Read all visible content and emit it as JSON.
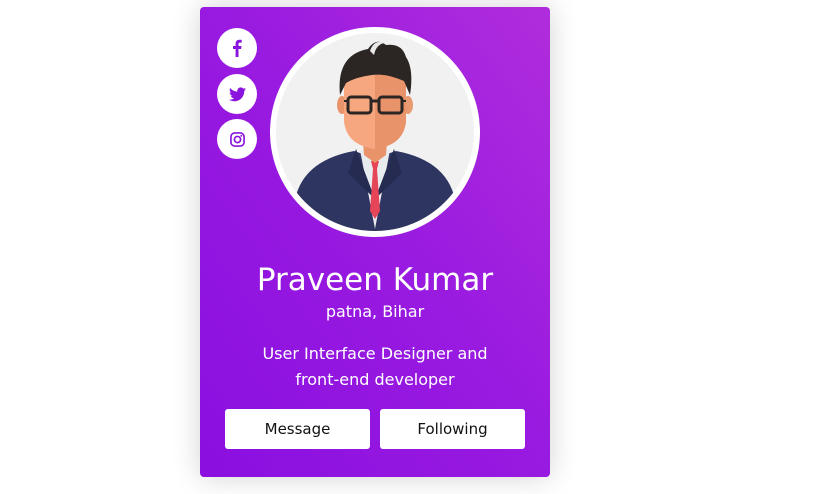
{
  "profile": {
    "name": "Praveen Kumar",
    "location": "patna, Bihar",
    "bio": "User Interface Designer and front-end developer"
  },
  "social": {
    "facebook_icon": "facebook-icon",
    "twitter_icon": "twitter-icon",
    "instagram_icon": "instagram-icon"
  },
  "actions": {
    "message_label": "Message",
    "following_label": "Following"
  },
  "colors": {
    "card_gradient_start": "#8a0fe0",
    "card_gradient_end": "#b02ddc",
    "icon_color": "#8a14de",
    "button_bg": "#ffffff"
  }
}
